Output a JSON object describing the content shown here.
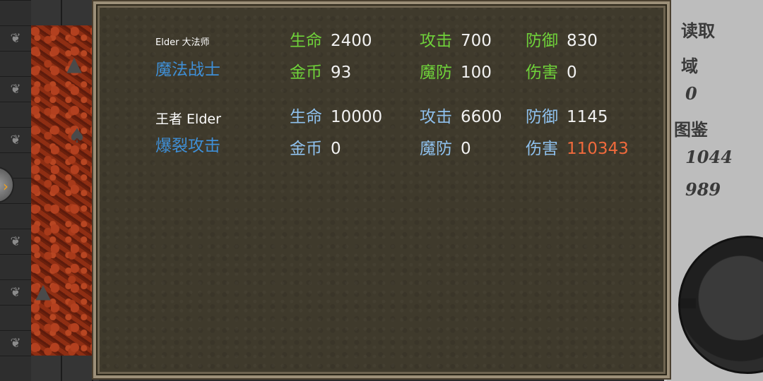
{
  "right_panel": {
    "load_label": "读取",
    "area_label": "域",
    "area_value": "0",
    "catalog_label": "图鉴",
    "value1": "1044",
    "value2": "989"
  },
  "entries": [
    {
      "name": "Elder 大法师",
      "skill": "魔法战士",
      "stats": {
        "hp_label": "生命",
        "hp": "2400",
        "atk_label": "攻击",
        "atk": "700",
        "def_label": "防御",
        "def": "830",
        "gold_label": "金币",
        "gold": "93",
        "mdef_label": "魔防",
        "mdef": "100",
        "dmg_label": "伤害",
        "dmg": "0"
      },
      "label_color": "green"
    },
    {
      "name": "王者 Elder",
      "skill": "爆裂攻击",
      "stats": {
        "hp_label": "生命",
        "hp": "10000",
        "atk_label": "攻击",
        "atk": "6600",
        "def_label": "防御",
        "def": "1145",
        "gold_label": "金币",
        "gold": "0",
        "mdef_label": "魔防",
        "mdef": "0",
        "dmg_label": "伤害",
        "dmg": "110343"
      },
      "label_color": "blue",
      "damage_color": "#f06a3c"
    }
  ],
  "map": {
    "left_arrow_icon": "chevron-right-icon"
  }
}
